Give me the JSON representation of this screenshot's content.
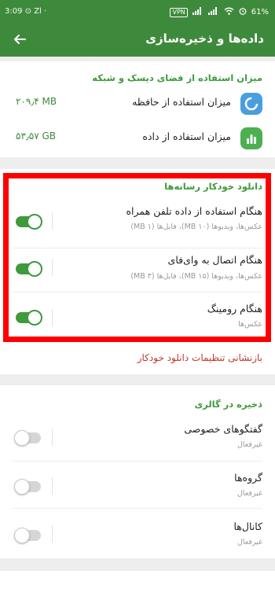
{
  "status_bar": {
    "left": "3:09 ⊙ Zl ·",
    "vpn": "VPN",
    "battery": "61",
    "icons": [
      "signal-icon",
      "signal-icon",
      "wifi-icon",
      "alarm-icon",
      "battery-icon"
    ]
  },
  "app_bar": {
    "title": "داده‌ها و ذخیره‌سازی",
    "back_icon": "back-arrow-icon"
  },
  "storage": {
    "section_title": "میزان استفاده از فضای دیسک و شبکه",
    "rows": [
      {
        "label": "میزان استفاده از حافظه",
        "value": "۲۰۹٫۴ MB",
        "icon": "pie-chart-icon",
        "color": "#4a9ee0"
      },
      {
        "label": "میزان استفاده از داده",
        "value": "۵۳٫۵۷ GB",
        "icon": "bar-chart-icon",
        "color": "#4caf50"
      }
    ]
  },
  "auto_download": {
    "section_title": "دانلود خودکار رسانه‌ها",
    "rows": [
      {
        "title": "هنگام استفاده از داده تلفن همراه",
        "subtitle": "عکس‌ها، ویدیوها (۱۰ MB)، فایل‌ها (۱ MB)",
        "enabled": true
      },
      {
        "title": "هنگام اتصال به وای‌فای",
        "subtitle": "عکس‌ها، ویدیوها (۱۵ MB)، فایل‌ها (۳ MB)",
        "enabled": true
      },
      {
        "title": "هنگام رومینگ",
        "subtitle": "عکس‌ها",
        "enabled": true
      }
    ],
    "reset_label": "بازنشانی تنظیمات دانلود خودکار"
  },
  "gallery": {
    "section_title": "ذخیره در گالری",
    "rows": [
      {
        "title": "گفتگوهای خصوصی",
        "subtitle": "غیرفعال",
        "enabled": false
      },
      {
        "title": "گروه‌ها",
        "subtitle": "غیرفعال",
        "enabled": false
      },
      {
        "title": "کانال‌ها",
        "subtitle": "غیرفعال",
        "enabled": false
      }
    ]
  },
  "colors": {
    "accent": "#3e8a3c",
    "highlight_box": "#ff0000",
    "reset_text": "#c0392b"
  }
}
